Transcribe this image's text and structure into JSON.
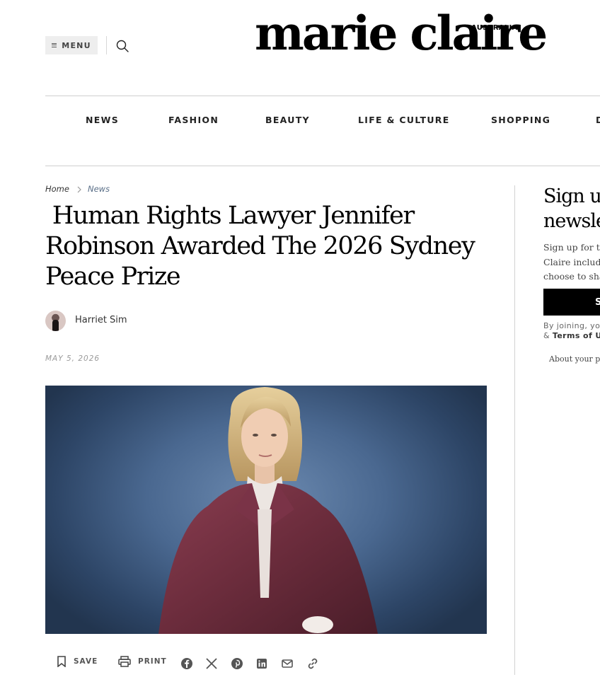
{
  "header": {
    "menu_label": "MENU",
    "logo_text": "marie claire",
    "logo_edition": "AUSTRALIA"
  },
  "nav": {
    "items": [
      {
        "label": "NEWS"
      },
      {
        "label": "FASHION"
      },
      {
        "label": "BEAUTY"
      },
      {
        "label": "LIFE & CULTURE"
      },
      {
        "label": "SHOPPING"
      },
      {
        "label": "D"
      }
    ]
  },
  "breadcrumb": {
    "home": "Home",
    "section": "News"
  },
  "article": {
    "headline": " Human Rights Lawyer Jennifer Robinson Awarded The 2026 Sydney Peace Prize",
    "author": "Harriet Sim",
    "date": "MAY 5, 2026"
  },
  "actions": {
    "save_label": "SAVE",
    "print_label": "PRINT",
    "share_icons": [
      "facebook-icon",
      "x-icon",
      "pinterest-icon",
      "linkedin-icon",
      "email-icon",
      "link-icon"
    ]
  },
  "newsletter": {
    "title": "Sign up\nnewsle",
    "text": "Sign up for th\nClaire includ\nchoose to sha",
    "button_label": "S",
    "legal_prefix": "By joining, you\n& ",
    "legal_link": "Terms of U",
    "privacy_link": "About your pr"
  },
  "colors": {
    "accent": "#000000",
    "breadcrumb_section": "#5a6f88",
    "jacket": "#6b2c3c"
  }
}
